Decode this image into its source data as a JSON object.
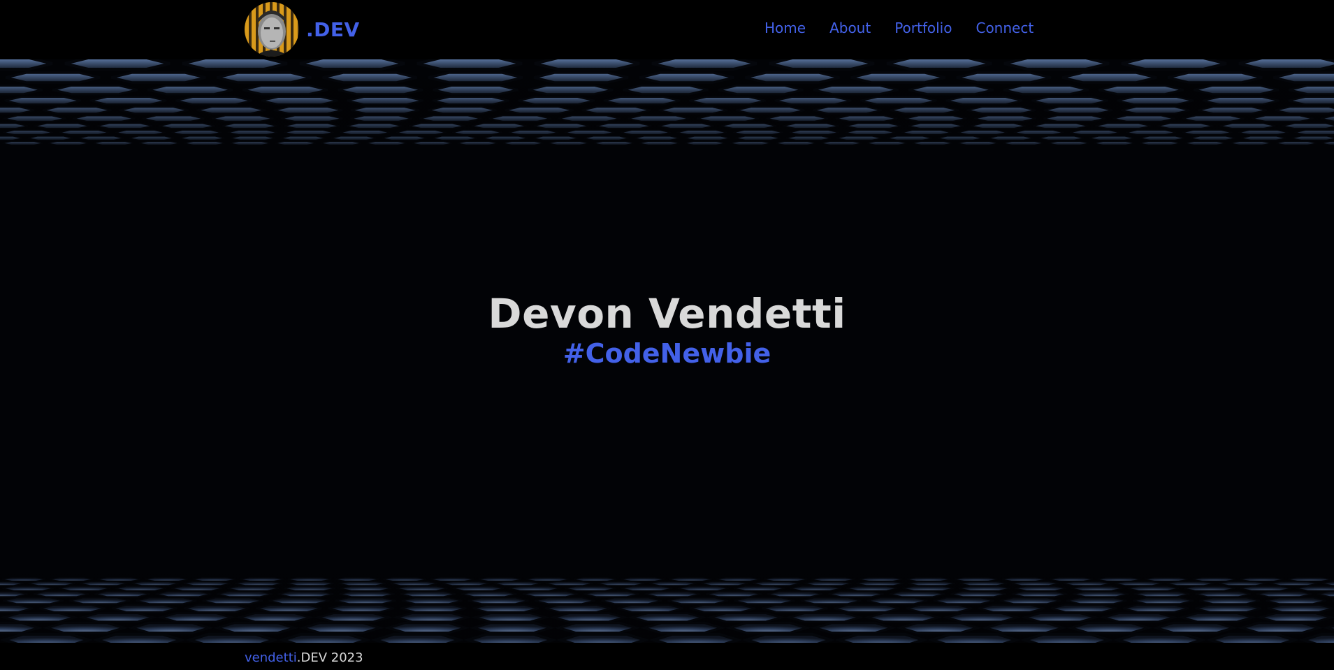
{
  "header": {
    "logo_text": ".DEV",
    "nav": [
      {
        "label": "Home"
      },
      {
        "label": "About"
      },
      {
        "label": "Portfolio"
      },
      {
        "label": "Connect"
      }
    ]
  },
  "hero": {
    "name": "Devon Vendetti",
    "tagline": "#CodeNewbie"
  },
  "footer": {
    "brand": "vendetti",
    "rest": ".DEV 2023"
  },
  "colors": {
    "accent": "#4361e8",
    "text_light": "#d9d9d9",
    "background": "#000000"
  }
}
